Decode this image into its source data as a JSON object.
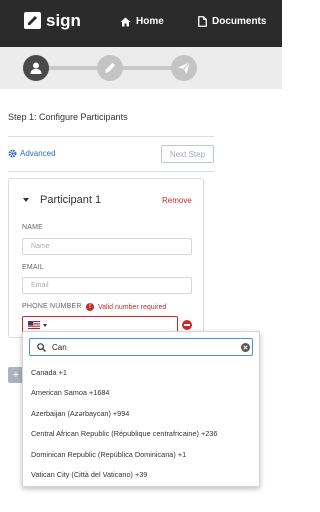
{
  "app": {
    "logo_text": "sign"
  },
  "nav": {
    "home_label": "Home",
    "documents_label": "Documents"
  },
  "progress": {
    "steps": [
      "user-icon",
      "pencil-icon",
      "send-icon"
    ],
    "active_step": 1
  },
  "page": {
    "step_title": "Step 1: Configure Participants",
    "advanced_label": "Advanced",
    "next_step_label": "Next Step"
  },
  "participant": {
    "title": "Participant 1",
    "remove_label": "Remove",
    "name_label": "NAME",
    "name_placeholder": "Name",
    "email_label": "EMAIL",
    "email_placeholder": "Email",
    "phone_label": "PHONE NUMBER",
    "phone_error": "Valid number required",
    "error_icon_text": "!"
  },
  "add_button_label": "+",
  "country_dropdown": {
    "search_value": "Can",
    "options": [
      "Canada +1",
      "American Samoa +1684",
      "Azerbaijan (Azərbaycan) +994",
      "Central African Republic (République centrafricaine) +236",
      "Dominican Republic (República Dominicana) +1",
      "Vatican City (Città del Vaticano) +39"
    ]
  },
  "colors": {
    "topbar": "#2b2b2b",
    "accent_blue": "#2c6fb7",
    "error_red": "#cc2a2a"
  }
}
